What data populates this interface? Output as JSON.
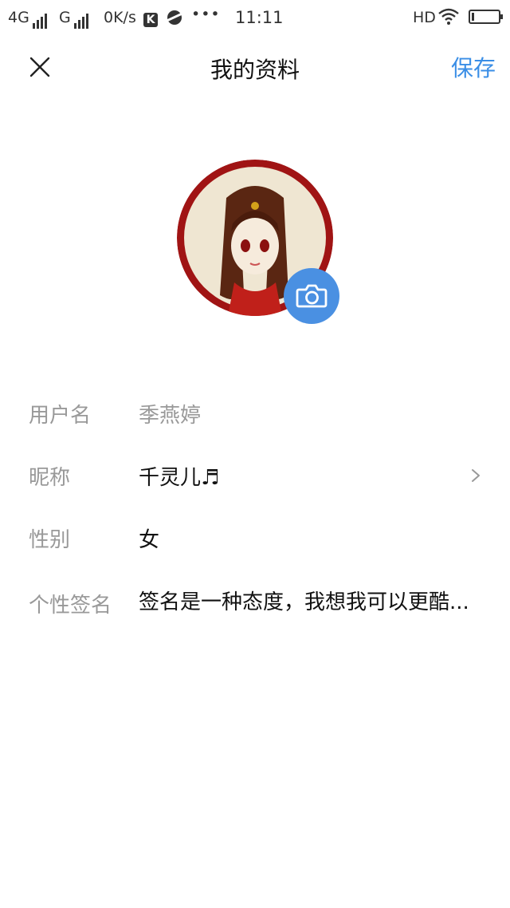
{
  "status_bar": {
    "network1": "4G",
    "network2": "G",
    "speed": "0K/s",
    "app_badge": "K",
    "more": "•••",
    "time": "11:11",
    "hd": "HD",
    "battery_level_percent": 10
  },
  "header": {
    "title": "我的资料",
    "save_label": "保存"
  },
  "profile": {
    "username_label": "用户名",
    "username_value": "季燕婷",
    "nickname_label": "昵称",
    "nickname_value": "千灵儿♬",
    "gender_label": "性别",
    "gender_value": "女",
    "signature_label": "个性签名",
    "signature_value": "签名是一种态度，我想我可以更酷..."
  },
  "colors": {
    "accent": "#3a8ee6",
    "camera_button": "#4a90e2",
    "label_gray": "#999999",
    "avatar_ring": "#a01414"
  },
  "icons": {
    "close": "close-icon",
    "camera": "camera-icon",
    "chevron": "chevron-right-icon"
  }
}
